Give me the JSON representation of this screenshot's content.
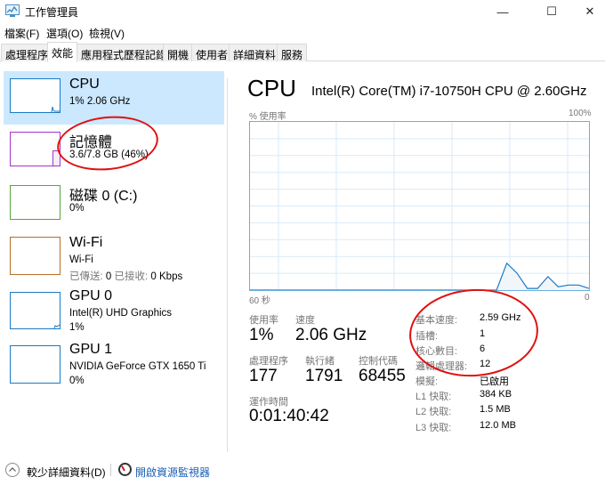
{
  "window": {
    "title": "工作管理員",
    "controls": {
      "minimize": "—",
      "maximize": "☐",
      "close": "✕"
    }
  },
  "menu": [
    "檔案(F)",
    "選項(O)",
    "檢視(V)"
  ],
  "tabs": [
    {
      "label": "處理程序",
      "active": false
    },
    {
      "label": "效能",
      "active": true
    },
    {
      "label": "應用程式歷程記錄",
      "active": false
    },
    {
      "label": "開機",
      "active": false
    },
    {
      "label": "使用者",
      "active": false
    },
    {
      "label": "詳細資料",
      "active": false
    },
    {
      "label": "服務",
      "active": false
    }
  ],
  "sidebar": {
    "items": [
      {
        "title": "CPU",
        "line1": "1% 2.06 GHz",
        "line2": "",
        "color": "#1a7ac4",
        "selected": true
      },
      {
        "title": "記憶體",
        "line1": "3.6/7.8 GB (46%)",
        "line2": "",
        "color": "#a335c8",
        "selected": false
      },
      {
        "title": "磁碟 0 (C:)",
        "line1": "0%",
        "line2": "",
        "color": "#56a63a",
        "selected": false
      },
      {
        "title": "Wi-Fi",
        "line1": "Wi-Fi",
        "line2_sent_label": "已傳送:",
        "line2_sent": "0",
        "line2_recv_label": "已接收:",
        "line2_recv": "0 Kbps",
        "color": "#b86e26",
        "selected": false
      },
      {
        "title": "GPU 0",
        "line1": "Intel(R) UHD Graphics",
        "line2": "1%",
        "color": "#1a7ac4",
        "selected": false
      },
      {
        "title": "GPU 1",
        "line1": "NVIDIA GeForce GTX 1650 Ti",
        "line2": "0%",
        "color": "#1a7ac4",
        "selected": false
      }
    ]
  },
  "main": {
    "title": "CPU",
    "model": "Intel(R) Core(TM) i7-10750H CPU @ 2.60GHz",
    "graph": {
      "y_label": "% 使用率",
      "y_max_label": "100%",
      "x_left_label": "60 秒",
      "x_right_label": "0"
    },
    "stats": {
      "usage_label": "使用率",
      "usage_value": "1%",
      "speed_label": "速度",
      "speed_value": "2.06 GHz",
      "processes_label": "處理程序",
      "processes_value": "177",
      "threads_label": "執行緒",
      "threads_value": "1791",
      "handles_label": "控制代碼",
      "handles_value": "68455",
      "uptime_label": "運作時間",
      "uptime_value": "0:01:40:42"
    },
    "specs": [
      {
        "label": "基本速度:",
        "value": "2.59 GHz"
      },
      {
        "label": "插槽:",
        "value": "1"
      },
      {
        "label": "核心數目:",
        "value": "6"
      },
      {
        "label": "邏輯處理器:",
        "value": "12"
      },
      {
        "label": "模擬:",
        "value": "已啟用"
      },
      {
        "label": "L1 快取:",
        "value": "384 KB"
      },
      {
        "label": "L2 快取:",
        "value": "1.5 MB"
      },
      {
        "label": "L3 快取:",
        "value": "12.0 MB"
      }
    ]
  },
  "footer": {
    "fewer_details": "較少詳細資料(D)",
    "open_monitor": "開啟資源監視器"
  },
  "chart_data": {
    "type": "area",
    "title": "CPU % 使用率",
    "xlabel": "",
    "ylabel": "% 使用率",
    "x_range_seconds": [
      60,
      0
    ],
    "ylim": [
      0,
      100
    ],
    "grid": true,
    "x": [
      60,
      58,
      56,
      54,
      52,
      50,
      48,
      46,
      44,
      42,
      40,
      38,
      36,
      34,
      32,
      30,
      28,
      26,
      24,
      22,
      20,
      18,
      16,
      14,
      12,
      10,
      8,
      6,
      4,
      2,
      0
    ],
    "values": [
      0,
      0,
      0,
      0,
      0,
      0,
      0,
      0,
      0,
      0,
      0,
      0,
      0,
      0,
      0,
      0,
      0,
      0,
      0,
      0,
      0,
      0,
      0,
      0,
      0,
      16,
      10,
      1,
      1,
      8,
      2,
      3,
      3,
      1
    ],
    "color": "#1a7ac4"
  }
}
